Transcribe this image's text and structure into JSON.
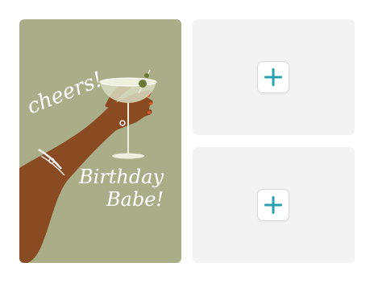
{
  "card": {
    "front": {
      "greeting_line1": "cheers!",
      "greeting_line2": "Birthday",
      "greeting_line3": "Babe!",
      "background_color": "#a9ad88"
    }
  },
  "slots": [
    {
      "icon": "plus-icon",
      "accent_color": "#2aa0b0"
    },
    {
      "icon": "plus-icon",
      "accent_color": "#2aa0b0"
    }
  ]
}
